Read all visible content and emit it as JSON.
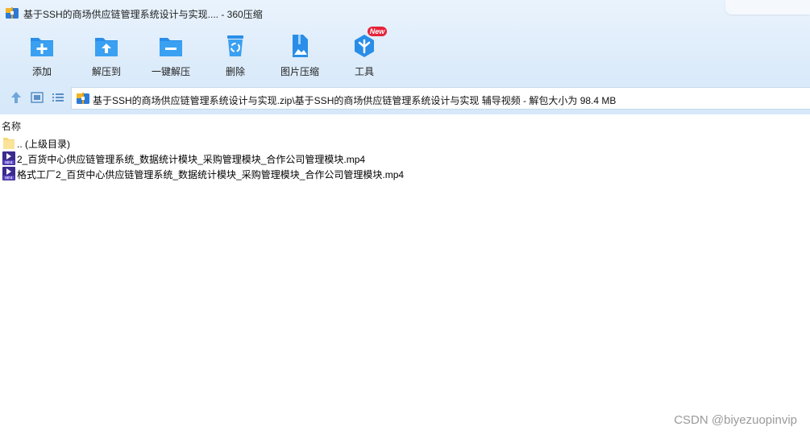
{
  "window": {
    "title": "基于SSH的商场供应链管理系统设计与实现.... - 360压缩"
  },
  "toolbar": {
    "items": [
      {
        "label": "添加",
        "icon": "add-icon"
      },
      {
        "label": "解压到",
        "icon": "extract-to-icon"
      },
      {
        "label": "一键解压",
        "icon": "one-click-extract-icon"
      },
      {
        "label": "删除",
        "icon": "recycle-delete-icon"
      },
      {
        "label": "图片压缩",
        "icon": "image-compress-icon"
      },
      {
        "label": "工具",
        "icon": "tools-icon"
      }
    ],
    "new_badge": "New"
  },
  "nav": {
    "path": "基于SSH的商场供应链管理系统设计与实现.zip\\基于SSH的商场供应链管理系统设计与实现 辅导视频 - 解包大小为 98.4 MB"
  },
  "list": {
    "header_name": "名称",
    "rows": [
      {
        "name": ".. (上级目录)",
        "type": "folder"
      },
      {
        "name": "2_百货中心供应链管理系统_数据统计模块_采购管理模块_合作公司管理模块.mp4",
        "type": "mp4"
      },
      {
        "name": "格式工厂2_百货中心供应链管理系统_数据统计模块_采购管理模块_合作公司管理模块.mp4",
        "type": "mp4"
      }
    ]
  },
  "watermark": "CSDN @biyezuopinvip",
  "colors": {
    "accent_blue": "#2a8ee8",
    "badge_red": "#e6233a"
  }
}
